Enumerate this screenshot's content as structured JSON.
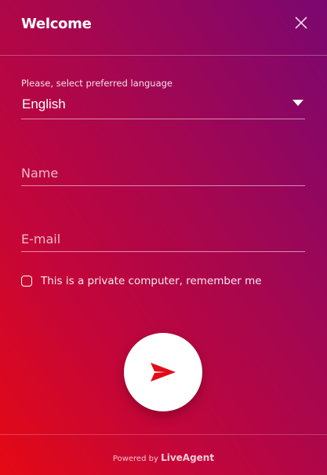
{
  "header": {
    "title": "Welcome",
    "close_icon": "close-icon"
  },
  "language": {
    "label": "Please, select preferred language",
    "selected": "English"
  },
  "form": {
    "name_placeholder": "Name",
    "email_placeholder": "E-mail",
    "remember_label": "This is a private computer, remember me",
    "remember_checked": false
  },
  "send_button": {
    "icon": "send-icon"
  },
  "footer": {
    "powered_by": "Powered by",
    "brand": "LiveAgent"
  },
  "colors": {
    "gradient_start": "#e50914",
    "gradient_end": "#7a0770",
    "accent_icon": "#e30b17"
  }
}
